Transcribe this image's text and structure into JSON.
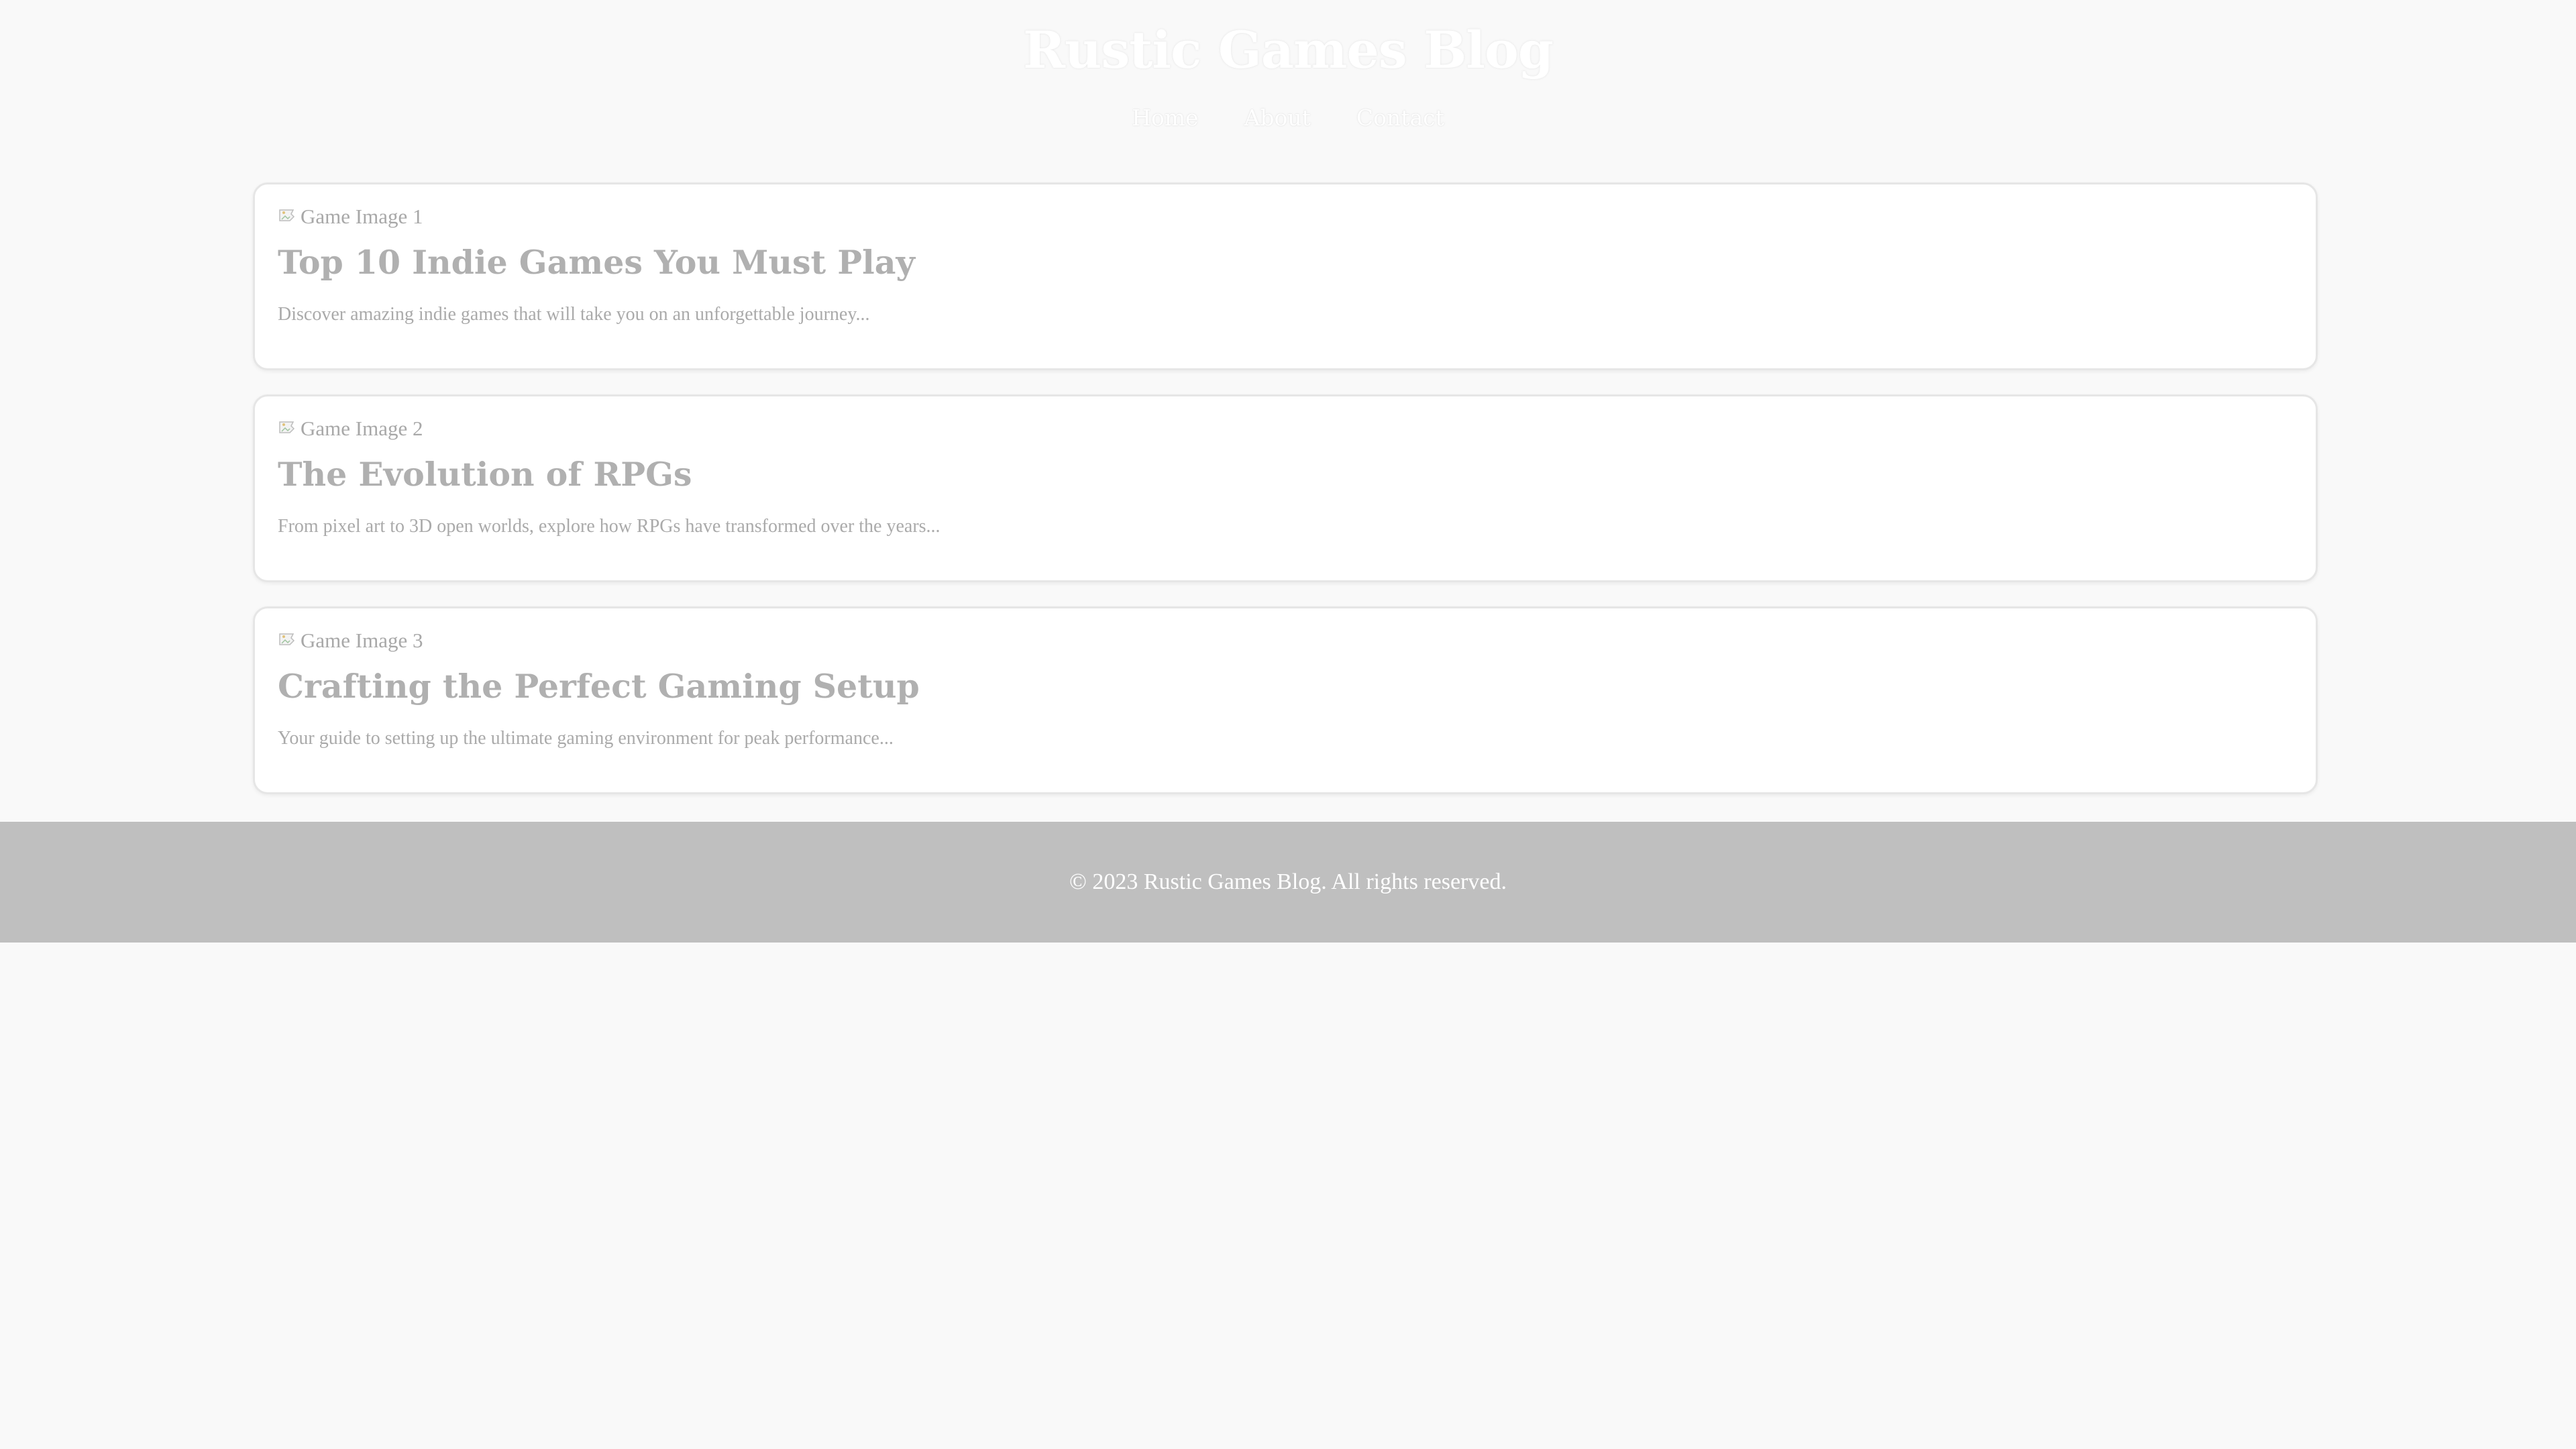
{
  "header": {
    "site_title": "Rustic Games Blog",
    "nav": [
      {
        "label": "Home"
      },
      {
        "label": "About"
      },
      {
        "label": "Contact"
      }
    ]
  },
  "posts": [
    {
      "image_alt": "Game Image 1",
      "title": "Top 10 Indie Games You Must Play",
      "excerpt": "Discover amazing indie games that will take you on an unforgettable journey..."
    },
    {
      "image_alt": "Game Image 2",
      "title": "The Evolution of RPGs",
      "excerpt": "From pixel art to 3D open worlds, explore how RPGs have transformed over the years..."
    },
    {
      "image_alt": "Game Image 3",
      "title": "Crafting the Perfect Gaming Setup",
      "excerpt": "Your guide to setting up the ultimate gaming environment for peak performance..."
    }
  ],
  "footer": {
    "copyright": "© 2023 Rustic Games Blog. All rights reserved."
  },
  "colors": {
    "page_background": "#f9f9f9",
    "footer_background": "#bfbfbf",
    "card_background": "#ffffff",
    "title_text": "#b0b0b0"
  }
}
